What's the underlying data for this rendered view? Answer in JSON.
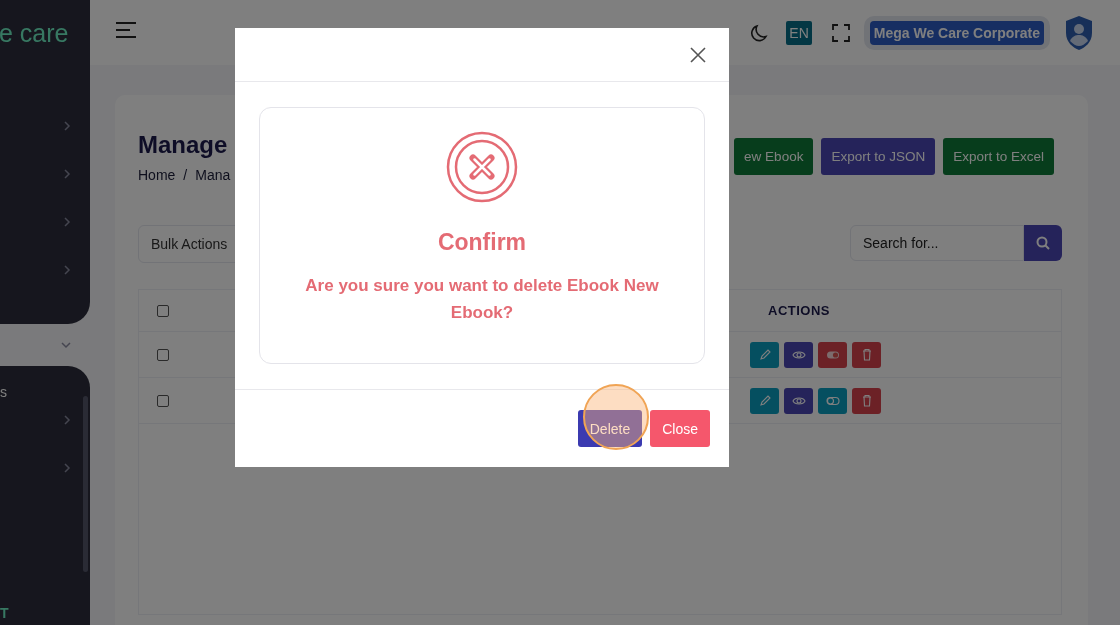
{
  "sidebar": {
    "logo_text": "e care",
    "section_label": "s",
    "footer_label": "T"
  },
  "topbar": {
    "language": "EN",
    "company": "Mega We Care Corporate"
  },
  "page": {
    "title": "Manage",
    "breadcrumb": [
      "Home",
      "Mana"
    ],
    "breadcrumb_separator": "/",
    "header_buttons": [
      {
        "label": "ew Ebook",
        "kind": "add"
      },
      {
        "label": "Export to JSON",
        "kind": "json"
      },
      {
        "label": "Export to Excel",
        "kind": "excel"
      }
    ],
    "bulk_actions": "Bulk Actions",
    "search": {
      "placeholder": "Search for..."
    }
  },
  "table": {
    "select_all_checked": false,
    "actions_header": "ACTIONS",
    "rows": [
      {
        "checked": false,
        "active": true
      },
      {
        "checked": false,
        "active": false
      }
    ]
  },
  "modal": {
    "title": "Confirm",
    "message": "Are you sure you want to delete Ebook New Ebook?",
    "buttons": [
      {
        "label": "Delete",
        "kind": "confirm"
      },
      {
        "label": "Close",
        "kind": "cancel"
      }
    ]
  }
}
